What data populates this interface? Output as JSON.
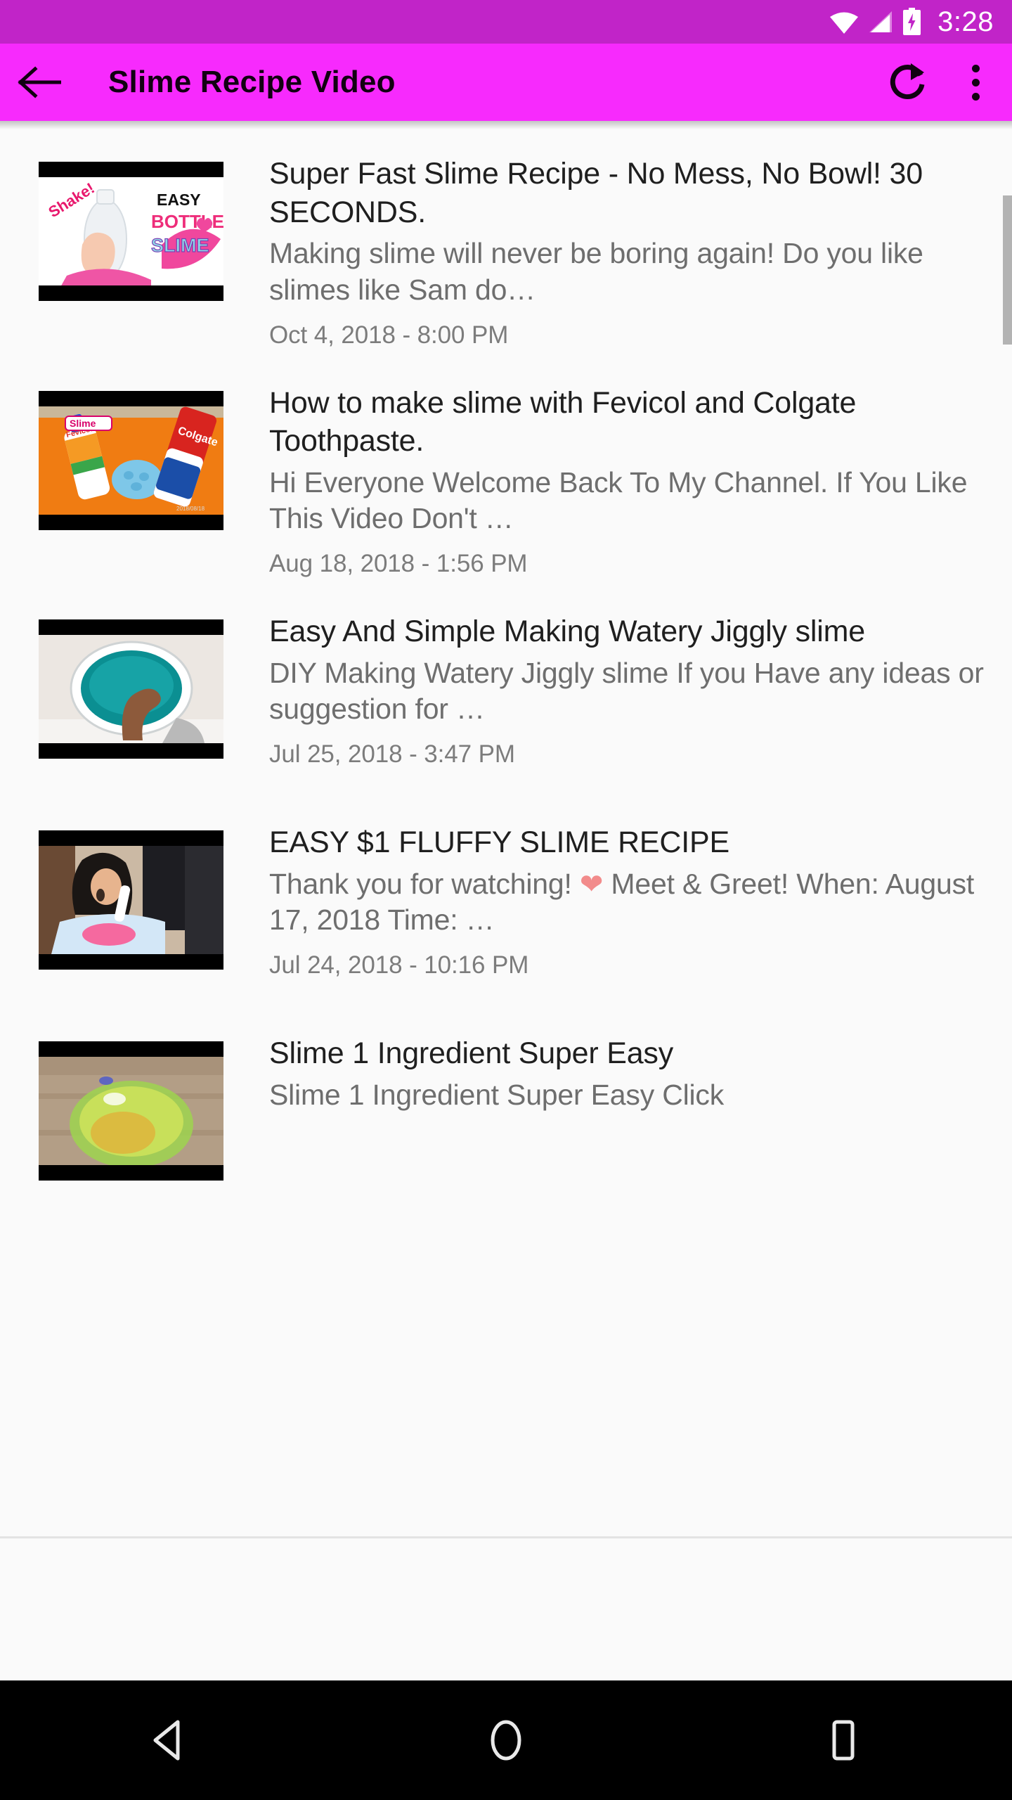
{
  "status_bar": {
    "time": "3:28",
    "icons": [
      "wifi-icon",
      "cell-signal-icon",
      "battery-charging-icon"
    ],
    "background_color": "#c124c8"
  },
  "toolbar": {
    "title": "Slime Recipe Video",
    "back_label": "back-arrow",
    "refresh_label": "refresh",
    "overflow_label": "more options",
    "background_color": "#f72afd",
    "text_color": "#120012"
  },
  "list": {
    "items": [
      {
        "title": "Super Fast Slime Recipe - No Mess, No Bowl! 30 SECONDS.",
        "description": "Making slime will never be boring again! Do you like slimes like Sam do…",
        "date": "Oct 4, 2018 - 8:00 PM",
        "thumbnail_alt": "Hand shaking a clear bottle with pink slime, text EASY BOTTLE SLIME"
      },
      {
        "title": "How to make slime with Fevicol and Colgate Toothpaste.",
        "description": "Hi Everyone Welcome Back To My Channel. If You Like This Video Don't …",
        "date": "Aug 18, 2018 - 1:56 PM",
        "thumbnail_alt": "Fevicol glue bottle, Colgate toothpaste and blue slime on orange table"
      },
      {
        "title": "Easy And Simple Making Watery Jiggly slime",
        "description": "DIY Making Watery Jiggly slime If you Have any ideas or suggestion for …",
        "date": "Jul 25, 2018 - 3:47 PM",
        "thumbnail_alt": "Hand dipping into a bowl of teal watery slime"
      },
      {
        "title": "EASY $1 FLUFFY SLIME RECIPE",
        "description_before_emoji": "Thank you for watching! ",
        "emoji": "❤",
        "description_after_emoji": "  Meet & Greet! When: August 17, 2018 Time: …",
        "description": "Thank you for watching! ❤  Meet & Greet! When: August 17, 2018 Time: …",
        "date": "Jul 24, 2018 - 10:16 PM",
        "thumbnail_alt": "Girl pouring glue into a tray of pink fluffy slime"
      },
      {
        "title": "Slime 1 Ingredient Super Easy",
        "description": "Slime 1 Ingredient Super Easy Click",
        "date": "",
        "thumbnail_alt": "Green slime in a glass bowl on a wooden table"
      }
    ]
  },
  "nav_bar": {
    "buttons": [
      "back-triangle",
      "home-circle",
      "recents-square"
    ],
    "background_color": "#000000"
  }
}
